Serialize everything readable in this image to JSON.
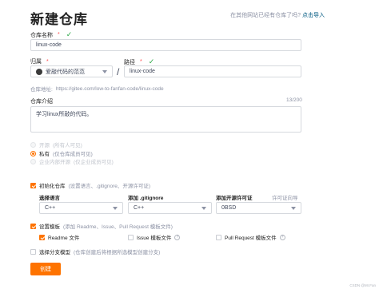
{
  "page": {
    "title": "新建仓库",
    "import_hint": "在其他网站已经有仓库了吗?",
    "import_link": "点击导入"
  },
  "repo_name": {
    "label": "仓库名称",
    "required_mark": "*",
    "value": "linux-code"
  },
  "owner": {
    "label": "归属",
    "required_mark": "*",
    "value": "爱敲代码的范范",
    "separator": "/"
  },
  "path": {
    "label": "路径",
    "required_mark": "*",
    "value": "linux-code"
  },
  "repo_url": {
    "label": "仓库地址:",
    "value": "https://gitee.com/low-to-fanfan-code/linux-code"
  },
  "description": {
    "label": "仓库介绍",
    "counter": "13/200",
    "value": "学习linux所敲的代码。"
  },
  "visibility": {
    "options": [
      {
        "label": "开源",
        "hint": "(所有人可见)",
        "selected": false,
        "disabled": true
      },
      {
        "label": "私有",
        "hint": "(仅仓库成员可见)",
        "selected": true,
        "disabled": false
      },
      {
        "label": "企业内部开源",
        "hint": "(仅企业成员可见)",
        "selected": false,
        "disabled": true
      }
    ]
  },
  "init_repo": {
    "label": "初始化仓库",
    "hint": "(设置语言、.gitignore、开源许可证)",
    "checked": true
  },
  "selects": {
    "language": {
      "label": "选择语言",
      "value": "C++"
    },
    "gitignore": {
      "label": "添加 .gitignore",
      "value": "C++"
    },
    "license": {
      "label": "添加开源许可证",
      "value": "0BSD",
      "help_link": "许可证向导"
    }
  },
  "template": {
    "label": "设置模板",
    "hint": "(添加 Readme、Issue、Pull Request 模板文件)",
    "checked": true,
    "files": [
      {
        "label": "Readme 文件",
        "checked": true
      },
      {
        "label": "Issue 模板文件",
        "checked": false
      },
      {
        "label": "Pull Request 模板文件",
        "checked": false
      }
    ],
    "help_marks": [
      "?",
      "?"
    ]
  },
  "branch_model": {
    "label": "选择分支模型",
    "hint": "(仓库创建后将根据所选模型创建分支)",
    "checked": false
  },
  "submit": {
    "label": "创建"
  },
  "watermark": "CSDN @Mr.Fan"
}
